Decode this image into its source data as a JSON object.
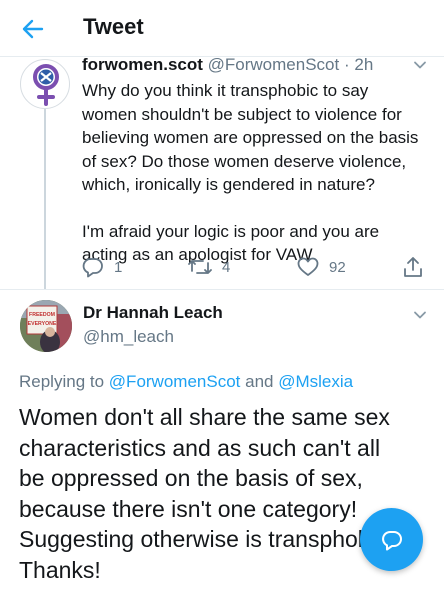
{
  "header": {
    "title": "Tweet"
  },
  "parent_tweet": {
    "name": "forwomen.scot",
    "handle": "@ForwomenScot",
    "separator": "·",
    "time": "2h",
    "paragraphs": [
      "Why do you think it transphobic to say women shouldn't be subject to violence for believing women are oppressed on the basis of sex? Do those women deserve violence, which, ironically is gendered in nature?",
      "I'm afraid your logic is poor and you are acting as an apologist for VAW"
    ],
    "reply_count": "1",
    "retweet_count": "4",
    "like_count": "92"
  },
  "main_tweet": {
    "name": "Dr Hannah Leach",
    "handle": "@hm_leach",
    "replying_prefix": "Replying to",
    "reply_handle_1": "@ForwomenScot",
    "replying_and": "and",
    "reply_handle_2": "@Mslexia",
    "lines": [
      "Women don't all share the same sex",
      "characteristics and as such can't all",
      "be oppressed on the basis of sex,",
      "because there isn't one category!",
      "Suggesting otherwise is transphobic.",
      "Thanks!"
    ],
    "avatar_sign_text": [
      "FREEDOM",
      "EVERYONE"
    ]
  },
  "colors": {
    "accent": "#1da1f2",
    "muted": "#657786",
    "text": "#14171a",
    "border": "#e6ecf0",
    "avatar1": "#7b4fb0"
  },
  "icons": [
    "back-arrow-icon",
    "chevron-down-icon",
    "reply-icon",
    "retweet-icon",
    "like-icon",
    "share-icon",
    "compose-reply-icon"
  ]
}
